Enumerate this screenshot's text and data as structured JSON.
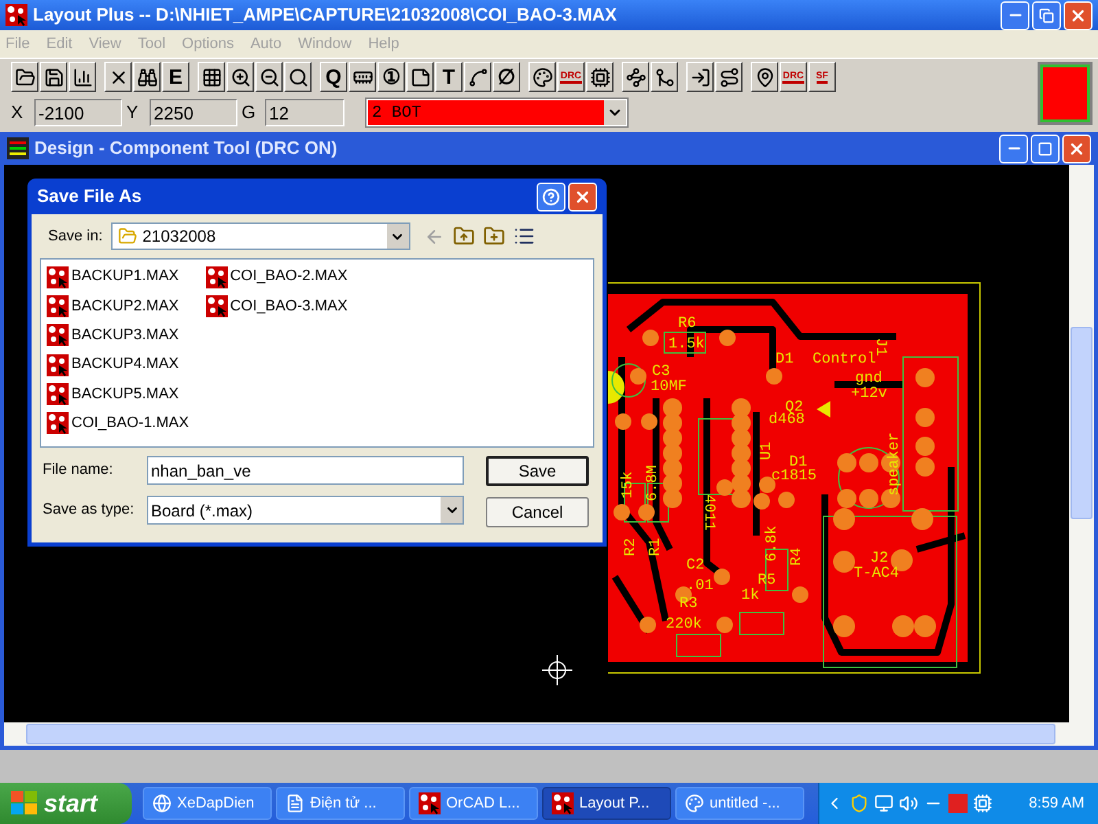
{
  "window": {
    "title": "Layout Plus -- D:\\NHIET_AMPE\\CAPTURE\\21032008\\COI_BAO-3.MAX"
  },
  "menu": [
    {
      "label": "File",
      "disabled": true
    },
    {
      "label": "Edit",
      "disabled": true
    },
    {
      "label": "View",
      "disabled": true
    },
    {
      "label": "Tool",
      "disabled": true
    },
    {
      "label": "Options",
      "disabled": true
    },
    {
      "label": "Auto",
      "disabled": true
    },
    {
      "label": "Window",
      "disabled": true
    },
    {
      "label": "Help",
      "disabled": true
    }
  ],
  "toolbar": [
    [
      {
        "kind": "icon"
      },
      {
        "kind": "icon"
      },
      {
        "kind": "icon"
      }
    ],
    [
      {
        "kind": "icon"
      },
      {
        "kind": "icon"
      },
      {
        "kind": "glyph",
        "text": "E"
      }
    ],
    [
      {
        "kind": "icon"
      },
      {
        "kind": "icon"
      },
      {
        "kind": "icon"
      },
      {
        "kind": "icon"
      }
    ],
    [
      {
        "kind": "glyph",
        "text": "Q"
      },
      {
        "kind": "icon"
      },
      {
        "kind": "glyph",
        "text": "①"
      },
      {
        "kind": "icon"
      },
      {
        "kind": "glyph",
        "text": "T"
      },
      {
        "kind": "icon"
      },
      {
        "kind": "glyph",
        "text": "∅"
      }
    ],
    [
      {
        "kind": "icon"
      },
      {
        "kind": "badge",
        "text": "DRC"
      },
      {
        "kind": "icon"
      }
    ],
    [
      {
        "kind": "icon"
      },
      {
        "kind": "icon"
      }
    ],
    [
      {
        "kind": "icon"
      },
      {
        "kind": "icon"
      }
    ],
    [
      {
        "kind": "icon"
      },
      {
        "kind": "badge",
        "text": "DRC"
      },
      {
        "kind": "badge",
        "text": "SF"
      }
    ]
  ],
  "coords": [
    {
      "label": "X",
      "value": "-2100"
    },
    {
      "label": "Y",
      "value": "2250"
    },
    {
      "label": "G",
      "value": "12"
    }
  ],
  "layer": {
    "value": "2  BOT",
    "color": "#ff0000"
  },
  "document": {
    "title": "Design - Component Tool (DRC ON)"
  },
  "board_labels": [
    "R6",
    "1.5k",
    "C3",
    "10MF",
    "D1",
    "Control",
    "J1",
    "gnd",
    "+12v",
    "Q2",
    "d468",
    "U1",
    "D1",
    "c1815",
    "speaker",
    "15k",
    "6.8M",
    "R2",
    "R1",
    "4011",
    "6.8k",
    "R4",
    "C2",
    ".01",
    "R5",
    "1k",
    "R3",
    "220k",
    "J2",
    "T-AC4"
  ],
  "dialog": {
    "title": "Save File As",
    "save_in_label": "Save in:",
    "save_in": "21032008",
    "files": [
      "BACKUP1.MAX",
      "BACKUP2.MAX",
      "BACKUP3.MAX",
      "BACKUP4.MAX",
      "BACKUP5.MAX",
      "COI_BAO-1.MAX",
      "COI_BAO-2.MAX",
      "COI_BAO-3.MAX"
    ],
    "file_name_label": "File name:",
    "file_name": "nhan_ban_ve",
    "type_label": "Save as type:",
    "type": "Board (*.max)",
    "buttons": [
      "Save",
      "Cancel"
    ]
  },
  "taskbar": {
    "start": "start",
    "tasks": [
      {
        "label": "XeDapDien",
        "selected": false
      },
      {
        "label": "Điện tử ...",
        "selected": false
      },
      {
        "label": "OrCAD L...",
        "selected": false
      },
      {
        "label": "Layout P...",
        "selected": true
      },
      {
        "label": "untitled -...",
        "selected": false
      }
    ],
    "clock": "8:59 AM"
  }
}
